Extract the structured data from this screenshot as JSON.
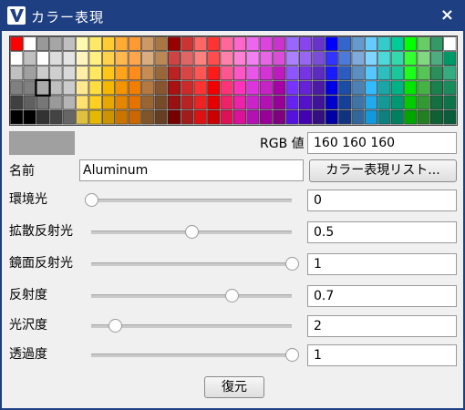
{
  "window": {
    "title": "カラー表現",
    "close_glyph": "×"
  },
  "palette": {
    "columns": [
      [
        "#ff0000",
        "#ffffff",
        "#c0c0c0",
        "#808080",
        "#404040",
        "#000000"
      ],
      [
        "#ffffff",
        "#c0c0c0",
        "#a0a0a0",
        "#808080",
        "#606060",
        "#000000"
      ],
      [
        "#999999",
        "#ffffff",
        "#cccccc",
        "#aaaaaa",
        "#777777",
        "#333333"
      ],
      [
        "#a6a6a6",
        "#dcdcdc",
        "#cfcfcf",
        "#bfbfbf",
        "#9a9a9a",
        "#444444"
      ],
      [
        "#c0c0c0",
        "#e4e4e4",
        "#d9d9d9",
        "#cccccc",
        "#b5b5b5",
        "#666666"
      ],
      [
        "#fff8b0",
        "#fff3c0",
        "#ffeea8",
        "#ffe890",
        "#ffe070",
        "#e0c040"
      ],
      [
        "#ffe866",
        "#fff080",
        "#ffe860",
        "#ffdd40",
        "#ffd020",
        "#e6b800"
      ],
      [
        "#ffcc33",
        "#ffd24d",
        "#ffc61a",
        "#f5b800",
        "#e6a800",
        "#cc9400"
      ],
      [
        "#ffaa33",
        "#ffb84d",
        "#ffa31a",
        "#f59300",
        "#e68600",
        "#cc7400"
      ],
      [
        "#ff9933",
        "#ffa64d",
        "#ff8c1a",
        "#f27d00",
        "#e67300",
        "#cc6600"
      ],
      [
        "#cc9966",
        "#d9ad80",
        "#c68c53",
        "#b37940",
        "#996633",
        "#80552a"
      ],
      [
        "#aa7744",
        "#bb8855",
        "#99663a",
        "#885530",
        "#774a2a",
        "#663f22"
      ],
      [
        "#990000",
        "#cc4444",
        "#bb2222",
        "#aa1111",
        "#991111",
        "#770000"
      ],
      [
        "#cc3333",
        "#e06666",
        "#d94444",
        "#cc2a2a",
        "#b82222",
        "#a31c1c"
      ],
      [
        "#ff6666",
        "#ff8080",
        "#ff5555",
        "#ff3333",
        "#ee2222",
        "#dd1111"
      ],
      [
        "#ff3333",
        "#ff4d4d",
        "#ff1a1a",
        "#f20000",
        "#e60000",
        "#cc0000"
      ],
      [
        "#ff6699",
        "#ff80aa",
        "#ff5591",
        "#ff3377",
        "#ee2266",
        "#dd1155"
      ],
      [
        "#ff66cc",
        "#ff80d5",
        "#ff55c6",
        "#ff33bb",
        "#ee22aa",
        "#dd1199"
      ],
      [
        "#ee66ee",
        "#f280f2",
        "#ea55ea",
        "#e033e0",
        "#cc22cc",
        "#b311b3"
      ],
      [
        "#dd44dd",
        "#e666e6",
        "#d633d6",
        "#c622c6",
        "#b311b3",
        "#990099"
      ],
      [
        "#cc33cc",
        "#d94dd9",
        "#bf1abf",
        "#a600a6",
        "#990099",
        "#800080"
      ],
      [
        "#9966ff",
        "#aa80ff",
        "#8c55ff",
        "#7733ff",
        "#6622ee",
        "#5511dd"
      ],
      [
        "#8844ee",
        "#9966f2",
        "#7733e6",
        "#6622d9",
        "#5511cc",
        "#4400b3"
      ],
      [
        "#6633cc",
        "#7a4dd9",
        "#5c2bbf",
        "#4d1aa6",
        "#401499",
        "#330f80"
      ],
      [
        "#0000ff",
        "#3333ff",
        "#1a1aff",
        "#0000e6",
        "#0000cc",
        "#0000a6"
      ],
      [
        "#3366cc",
        "#4d7ad9",
        "#2b5cbf",
        "#1a4da6",
        "#144099",
        "#0f3380"
      ],
      [
        "#6699cc",
        "#80aad9",
        "#5c8fbf",
        "#4d80b3",
        "#4073a6",
        "#336699"
      ],
      [
        "#66ccff",
        "#80d5ff",
        "#55c6ff",
        "#33bbff",
        "#22aaee",
        "#1199dd"
      ],
      [
        "#33cccc",
        "#4dd9d9",
        "#2bbfbf",
        "#1aa6a6",
        "#149999",
        "#0f8080"
      ],
      [
        "#00cc99",
        "#33d9ad",
        "#1ac69c",
        "#00b386",
        "#009973",
        "#008060"
      ],
      [
        "#00ff00",
        "#33ff33",
        "#1aff1a",
        "#00e600",
        "#00cc00",
        "#00a600"
      ],
      [
        "#66cc66",
        "#80d980",
        "#55c655",
        "#44b344",
        "#339933",
        "#228022"
      ],
      [
        "#339966",
        "#4dad80",
        "#2b8f5c",
        "#1a804d",
        "#147040",
        "#0f6033"
      ],
      [
        "#ffffff",
        "#009966",
        "#33ad80",
        "#1a8c5c",
        "#0f734a",
        "#0a5c3a"
      ]
    ],
    "selected": {
      "column": 2,
      "row": 3
    }
  },
  "current_color": {
    "swatch": "#a0a0a0"
  },
  "rgb": {
    "label": "RGB 値",
    "value": "160 160 160"
  },
  "name": {
    "label": "名前",
    "value": "Aluminum",
    "list_button": "カラー表現リスト..."
  },
  "properties": [
    {
      "label": "環境光",
      "value": "0",
      "level": 0.0
    },
    {
      "label": "拡散反射光",
      "value": "0.5",
      "level": 0.5
    },
    {
      "label": "鏡面反射光",
      "value": "1",
      "level": 1.0
    },
    {
      "label": "反射度",
      "value": "0.7",
      "level": 0.7
    },
    {
      "label": "光沢度",
      "value": "2",
      "level": 0.12
    },
    {
      "label": "透過度",
      "value": "1",
      "level": 1.0
    }
  ],
  "restore_button": "復元",
  "colors": {
    "titlebar": "#1e3f82",
    "window_bg": "#f0f0f0",
    "accent_icon": "#1e3f82"
  }
}
